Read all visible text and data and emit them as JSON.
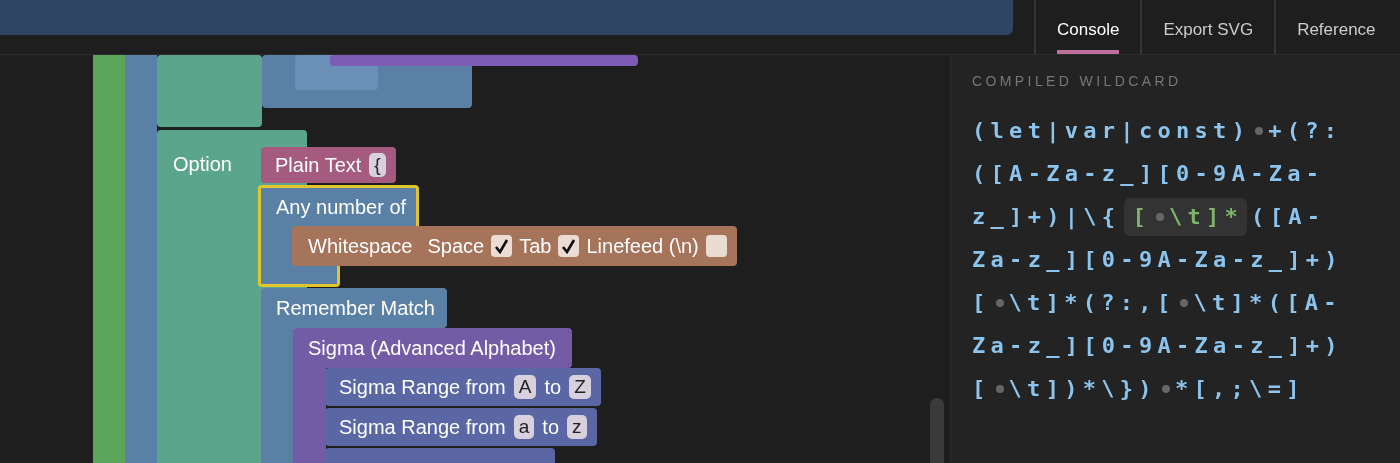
{
  "tabs": [
    {
      "label": "Console",
      "selected": true
    },
    {
      "label": "Export SVG",
      "selected": false
    },
    {
      "label": "Reference",
      "selected": false
    }
  ],
  "workspace": {
    "option": {
      "label": "Option"
    },
    "plain_text": {
      "label": "Plain Text",
      "value": "{"
    },
    "any_number": {
      "label": "Any number of",
      "selected": true
    },
    "whitespace": {
      "label": "Whitespace",
      "options": [
        {
          "label": "Space",
          "checked": true
        },
        {
          "label": "Tab",
          "checked": true
        },
        {
          "label": "Linefeed (\\n)",
          "checked": false
        }
      ]
    },
    "remember": {
      "label": "Remember Match"
    },
    "sigma": {
      "label": "Sigma (Advanced Alphabet)"
    },
    "ranges": [
      {
        "label": "Sigma Range from",
        "from": "A",
        "to_label": "to",
        "to": "Z"
      },
      {
        "label": "Sigma Range from",
        "from": "a",
        "to_label": "to",
        "to": "z"
      }
    ]
  },
  "panel": {
    "heading": "COMPILED WILDCARD",
    "lines": [
      [
        {
          "kind": "code",
          "text": "(let|var|const)"
        },
        {
          "kind": "space"
        },
        {
          "kind": "code",
          "text": "+(?:"
        }
      ],
      [
        {
          "kind": "code",
          "text": "([A-Za-z_][0-9A-Za-"
        }
      ],
      [
        {
          "kind": "code",
          "text": "z_]+)|\\{"
        },
        {
          "kind": "highlight",
          "parts": [
            {
              "kind": "code",
              "text": "["
            },
            {
              "kind": "space"
            },
            {
              "kind": "code",
              "text": "\\t]*"
            }
          ]
        },
        {
          "kind": "code",
          "text": "([A-"
        }
      ],
      [
        {
          "kind": "code",
          "text": "Za-z_][0-9A-Za-z_]+)"
        }
      ],
      [
        {
          "kind": "code",
          "text": "["
        },
        {
          "kind": "space"
        },
        {
          "kind": "code",
          "text": "\\t]*(?:,["
        },
        {
          "kind": "space"
        },
        {
          "kind": "code",
          "text": "\\t]*([A-"
        }
      ],
      [
        {
          "kind": "code",
          "text": "Za-z_][0-9A-Za-z_]+)"
        }
      ],
      [
        {
          "kind": "code",
          "text": "["
        },
        {
          "kind": "space"
        },
        {
          "kind": "code",
          "text": "\\t])*\\})"
        },
        {
          "kind": "space"
        },
        {
          "kind": "code",
          "text": "*[,;\\=]"
        }
      ]
    ]
  }
}
